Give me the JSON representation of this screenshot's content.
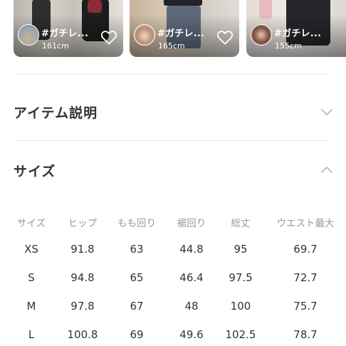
{
  "coordinates": [
    {
      "title": "#ガチレ...",
      "height": "161cm",
      "like_icon": "heart-outline-icon"
    },
    {
      "title": "#ガチレ...",
      "height": "165cm",
      "like_icon": "heart-outline-icon"
    },
    {
      "title": "#ガチレ...",
      "height": "155cm",
      "like_icon": "heart-outline-icon"
    }
  ],
  "sections": {
    "item_description": {
      "title": "アイテム説明",
      "chevron_icon": "chevron-down-icon",
      "expanded": false
    },
    "size": {
      "title": "サイズ",
      "chevron_icon": "chevron-up-icon",
      "expanded": true
    }
  },
  "size_table": {
    "headers": [
      "サイズ",
      "ヒップ",
      "もも回り",
      "裾回り",
      "総丈",
      "ウエスト最大"
    ],
    "rows": [
      [
        "XS",
        "91.8",
        "63",
        "44.8",
        "95",
        "69.7"
      ],
      [
        "S",
        "94.8",
        "65",
        "46.4",
        "97.5",
        "72.7"
      ],
      [
        "M",
        "97.8",
        "67",
        "48",
        "100",
        "75.7"
      ],
      [
        "L",
        "100.8",
        "69",
        "49.6",
        "102.5",
        "78.7"
      ]
    ]
  },
  "colors": {
    "text_primary": "#333333",
    "text_secondary": "#9a9a9a",
    "divider": "#ebebeb",
    "chevron": "#b5b5b5"
  }
}
